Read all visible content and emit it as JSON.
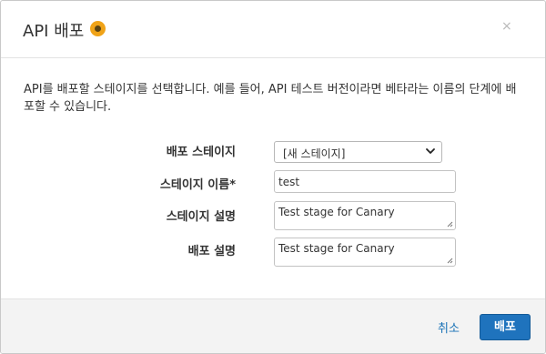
{
  "dialog": {
    "title": "API 배포",
    "close_label": "×"
  },
  "description": "API를 배포할 스테이지를 선택합니다. 예를 들어, API 테스트 버전이라면 베타라는 이름의 단계에 배포할 수 있습니다.",
  "form": {
    "stage_label": "배포 스테이지",
    "stage_selected": "[새 스테이지]",
    "stage_name_label": "스테이지 이름*",
    "stage_name_value": "test",
    "stage_desc_label": "스테이지 설명",
    "stage_desc_value": "Test stage for Canary",
    "deploy_desc_label": "배포 설명",
    "deploy_desc_value": "Test stage for Canary"
  },
  "footer": {
    "cancel_label": "취소",
    "deploy_label": "배포"
  },
  "colors": {
    "accent": "#1f73bd",
    "link": "#1b73b7",
    "help_icon": "#f0a318"
  }
}
